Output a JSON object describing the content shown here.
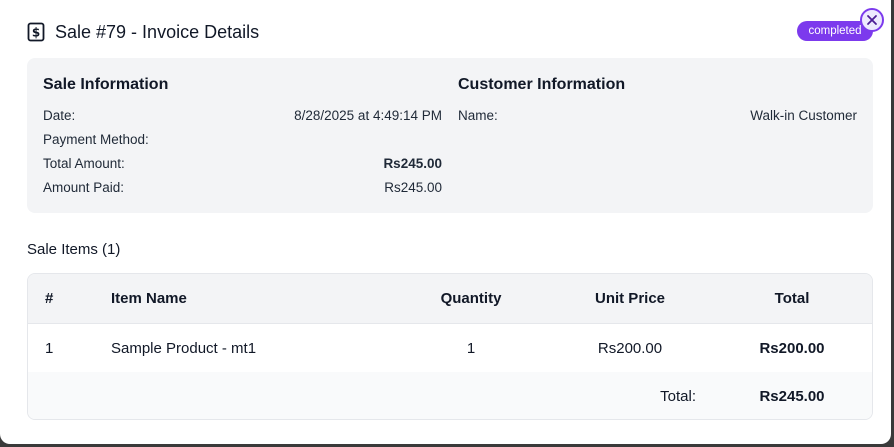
{
  "header": {
    "title": "Sale #79 - Invoice Details",
    "status": "completed"
  },
  "sale_info": {
    "title": "Sale Information",
    "rows": [
      {
        "label": "Date:",
        "value": "8/28/2025 at 4:49:14 PM"
      },
      {
        "label": "Payment Method:",
        "value": ""
      },
      {
        "label": "Total Amount:",
        "value": "Rs245.00"
      },
      {
        "label": "Amount Paid:",
        "value": "Rs245.00"
      }
    ]
  },
  "customer_info": {
    "title": "Customer Information",
    "rows": [
      {
        "label": "Name:",
        "value": "Walk-in Customer"
      }
    ]
  },
  "items": {
    "title": "Sale Items (1)",
    "columns": [
      "#",
      "Item Name",
      "Quantity",
      "Unit Price",
      "Total"
    ],
    "rows": [
      {
        "num": "1",
        "name": "Sample Product - mt1",
        "quantity": "1",
        "unit_price": "Rs200.00",
        "total": "Rs200.00"
      }
    ],
    "footer": {
      "label": "Total:",
      "value": "Rs245.00"
    }
  },
  "colors": {
    "accent": "#7c3aed",
    "panel": "#f3f4f6"
  }
}
